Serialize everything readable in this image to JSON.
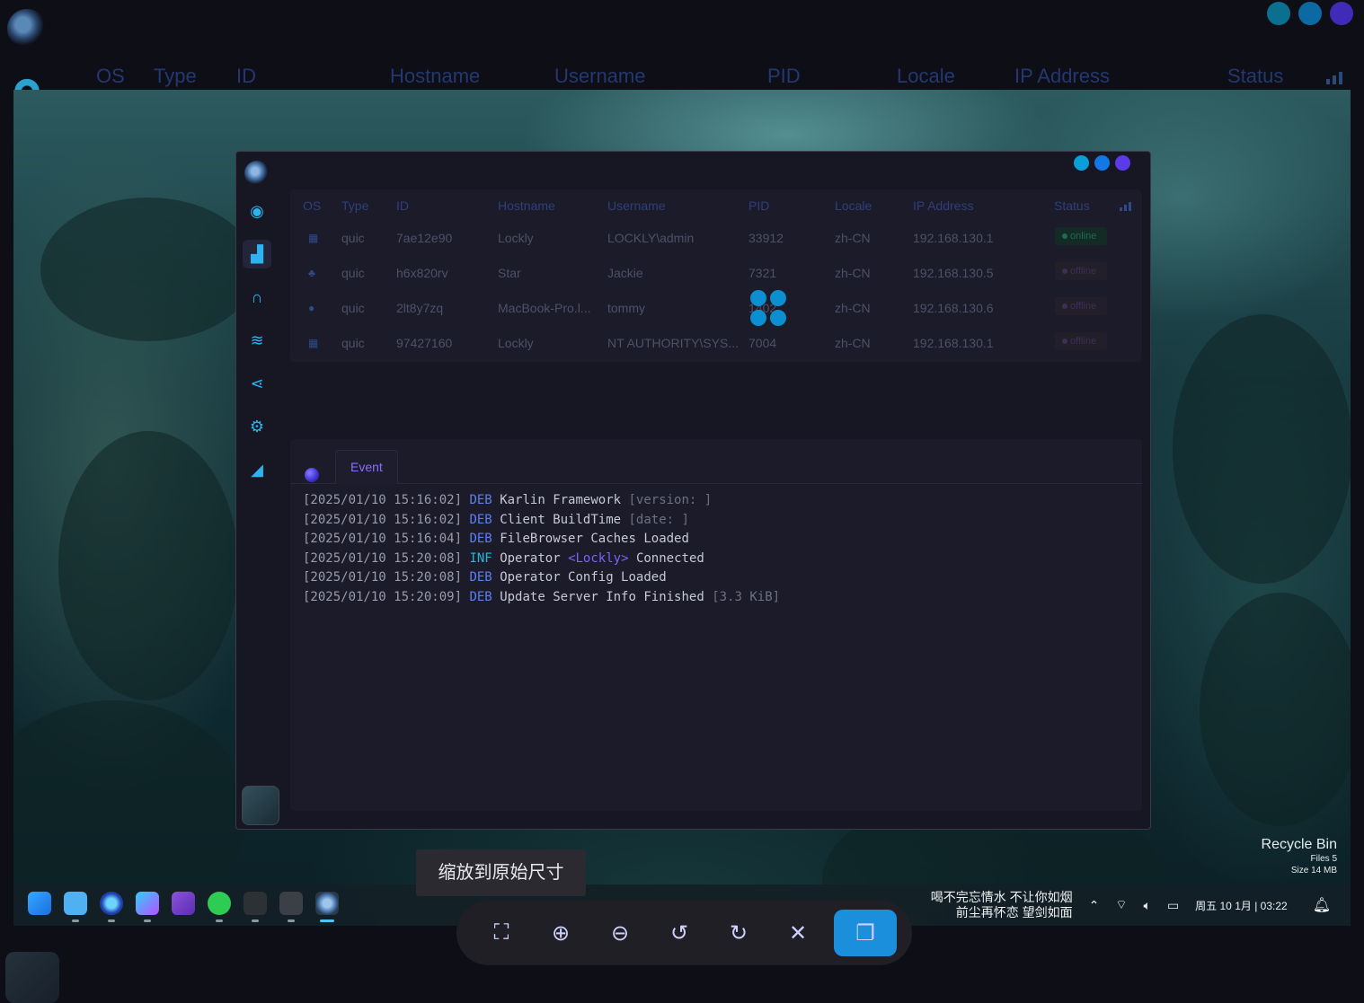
{
  "outer": {
    "window_dots": [
      "#0b7fa3",
      "#0c79b6",
      "#4a2fd6"
    ],
    "columns": [
      "OS",
      "Type",
      "ID",
      "Hostname",
      "Username",
      "PID",
      "Locale",
      "IP Address",
      "Status"
    ]
  },
  "window": {
    "dots": [
      "#0a9fd8",
      "#1178e6",
      "#5b3be8"
    ],
    "sidebar": [
      {
        "name": "sidebar-item-overview",
        "icon": "◉"
      },
      {
        "name": "sidebar-item-stats",
        "icon": "▟"
      },
      {
        "name": "sidebar-item-listeners",
        "icon": "∩"
      },
      {
        "name": "sidebar-item-trends",
        "icon": "≈"
      },
      {
        "name": "sidebar-item-graph",
        "icon": "⟨"
      },
      {
        "name": "sidebar-item-settings",
        "icon": "⚙"
      },
      {
        "name": "sidebar-item-charts",
        "icon": "◢"
      }
    ],
    "table": {
      "headers": [
        "OS",
        "Type",
        "ID",
        "Hostname",
        "Username",
        "PID",
        "Locale",
        "IP Address",
        "Status"
      ],
      "rows": [
        {
          "os": "windows",
          "type": "quic",
          "id": "7ae12e90",
          "hostname": "Lockly",
          "username": "LOCKLY\\admin",
          "pid": "33912",
          "locale": "zh-CN",
          "ip": "192.168.130.1",
          "status": "online"
        },
        {
          "os": "linux",
          "type": "quic",
          "id": "h6x820rv",
          "hostname": "Star",
          "username": "Jackie",
          "pid": "7321",
          "locale": "zh-CN",
          "ip": "192.168.130.5",
          "status": "offline"
        },
        {
          "os": "apple",
          "type": "quic",
          "id": "2lt8y7zq",
          "hostname": "MacBook-Pro.l...",
          "username": "tommy",
          "pid": "1402",
          "locale": "zh-CN",
          "ip": "192.168.130.6",
          "status": "offline"
        },
        {
          "os": "windows",
          "type": "quic",
          "id": "97427160",
          "hostname": "Lockly",
          "username": "NT AUTHORITY\\SYS...",
          "pid": "7004",
          "locale": "zh-CN",
          "ip": "192.168.130.1",
          "status": "offline"
        }
      ]
    },
    "log": {
      "tab": "Event",
      "lines": [
        {
          "ts": "[2025/01/10 15:16:02]",
          "level": "DEB",
          "msg": "Karlin Framework",
          "op": "",
          "rest": "",
          "extra": "[version: ]"
        },
        {
          "ts": "[2025/01/10 15:16:02]",
          "level": "DEB",
          "msg": "Client BuildTime",
          "op": "",
          "rest": "",
          "extra": "[date: ]"
        },
        {
          "ts": "[2025/01/10 15:16:04]",
          "level": "DEB",
          "msg": "FileBrowser Caches Loaded",
          "op": "",
          "rest": "",
          "extra": ""
        },
        {
          "ts": "[2025/01/10 15:20:08]",
          "level": "INF",
          "msg": "Operator",
          "op": "<Lockly>",
          "rest": "Connected",
          "extra": ""
        },
        {
          "ts": "[2025/01/10 15:20:08]",
          "level": "DEB",
          "msg": "Operator Config Loaded",
          "op": "",
          "rest": "",
          "extra": ""
        },
        {
          "ts": "[2025/01/10 15:20:09]",
          "level": "DEB",
          "msg": "Update Server Info Finished",
          "op": "",
          "rest": "",
          "extra": "[3.3 KiB]"
        }
      ]
    }
  },
  "desktop": {
    "recycle_bin": {
      "title": "Recycle Bin",
      "files": "Files 5",
      "size": "Size 14 MB"
    },
    "taskbar": {
      "apps": [
        "windows-start",
        "file-explorer",
        "browser",
        "goland",
        "visual-studio",
        "wechat",
        "audio-app",
        "terminal",
        "karlin-client"
      ],
      "lyrics_line1": "喝不完忘情水 不让你如烟",
      "lyrics_line2": "前尘再怀恋 望剑如面",
      "clock": "周五 10 1月 | 03:22"
    }
  },
  "viewer": {
    "tooltip": "缩放到原始尺寸",
    "buttons": [
      "fit-screen",
      "zoom-in",
      "zoom-out",
      "rotate-left",
      "rotate-right",
      "close",
      "copy"
    ]
  }
}
